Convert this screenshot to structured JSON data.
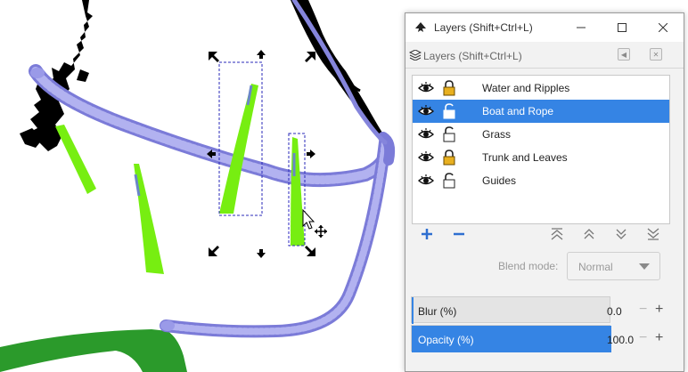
{
  "window": {
    "title": "Layers (Shift+Ctrl+L)",
    "dock_title": "Layers (Shift+Ctrl+L)"
  },
  "layers": [
    {
      "name": "Water and Ripples",
      "visible": true,
      "locked": true,
      "selected": false
    },
    {
      "name": "Boat and Rope",
      "visible": true,
      "locked": false,
      "selected": true
    },
    {
      "name": "Grass",
      "visible": true,
      "locked": false,
      "selected": false
    },
    {
      "name": "Trunk and Leaves",
      "visible": true,
      "locked": true,
      "selected": false
    },
    {
      "name": "Guides",
      "visible": true,
      "locked": false,
      "selected": false
    }
  ],
  "toolbar": {
    "add_icon": "plus-icon",
    "remove_icon": "minus-icon",
    "raise_top_icon": "raise-to-top-icon",
    "raise_icon": "raise-icon",
    "lower_icon": "lower-icon",
    "lower_bottom_icon": "lower-to-bottom-icon"
  },
  "blend": {
    "label": "Blend mode:",
    "value": "Normal"
  },
  "blur": {
    "label": "Blur (%)",
    "value": "0.0",
    "minus": "−",
    "plus": "+",
    "percent": 0
  },
  "opacity": {
    "label": "Opacity (%)",
    "value": "100.0",
    "minus": "−",
    "plus": "+",
    "percent": 100
  },
  "colors": {
    "accent": "#3584e4",
    "rope": "#9a9ae8",
    "grass": "#77ee11",
    "leaf_dark": "#2b9a2b",
    "ink": "#000000"
  }
}
